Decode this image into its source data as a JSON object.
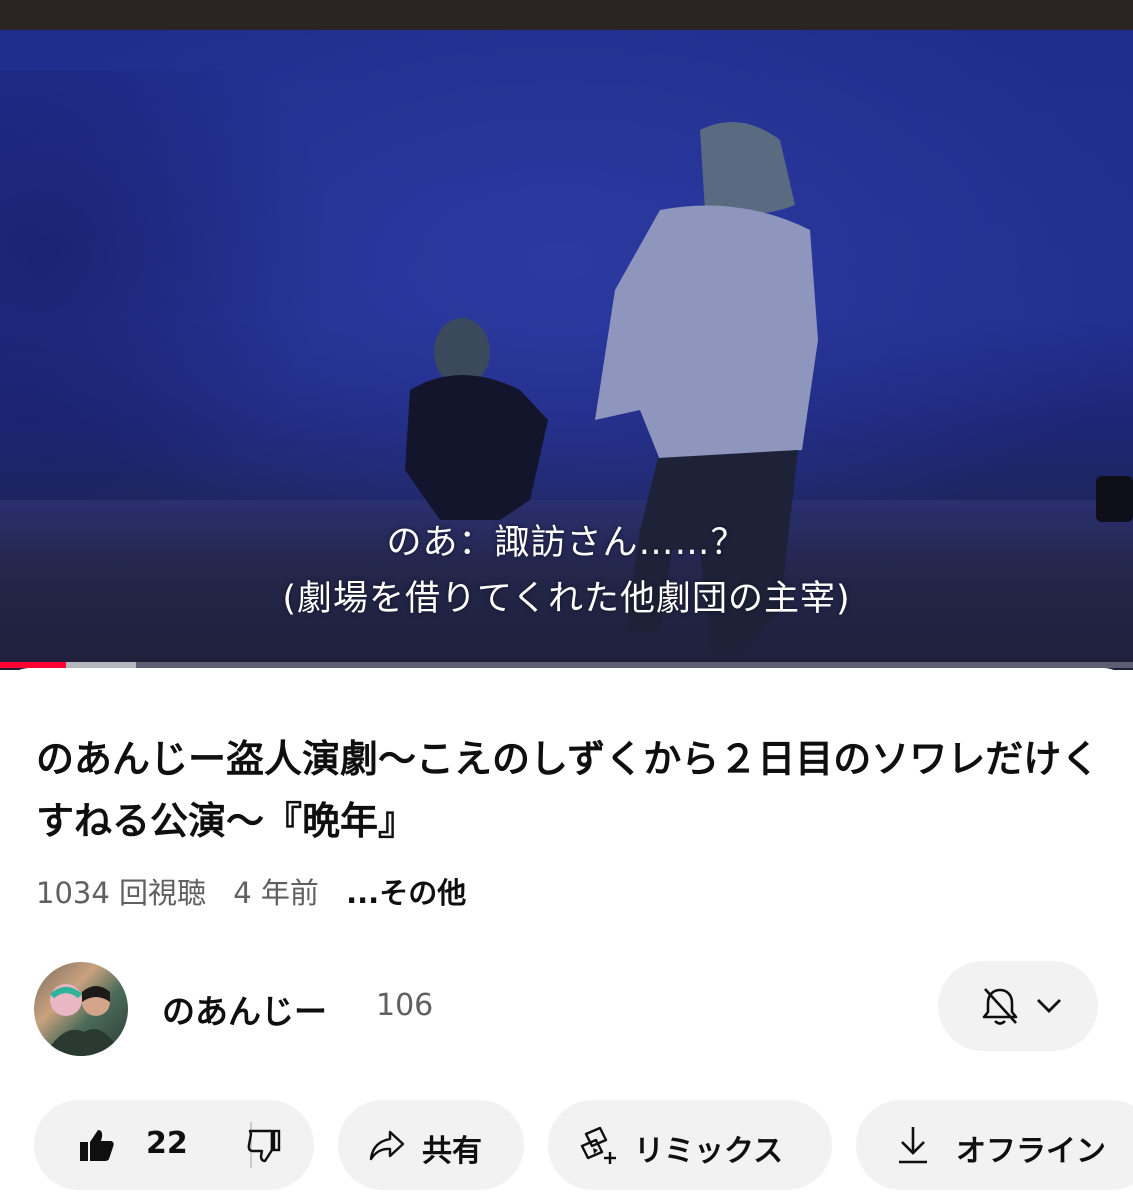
{
  "player": {
    "subtitle_line1": "のあ：諏訪さん……？",
    "subtitle_line2": "(劇場を借りてくれた他劇団の主宰)",
    "progress_played": 0.058,
    "progress_buffered": 0.12,
    "progress_color": "#ff0033"
  },
  "video": {
    "title": "のあんじー盗人演劇〜こえのしずくから２日目のソワレだけくすねる公演〜『晩年』",
    "views": "1034 回視聴",
    "age": "4 年前",
    "more": "...その他"
  },
  "channel": {
    "name": "のあんじー",
    "subscribers": "106",
    "bell_icon": "bell-off-icon",
    "menu_icon": "chevron-down-icon"
  },
  "actions": {
    "like_count": "22",
    "share_label": "共有",
    "remix_label": "リミックス",
    "offline_label": "オフライン"
  }
}
